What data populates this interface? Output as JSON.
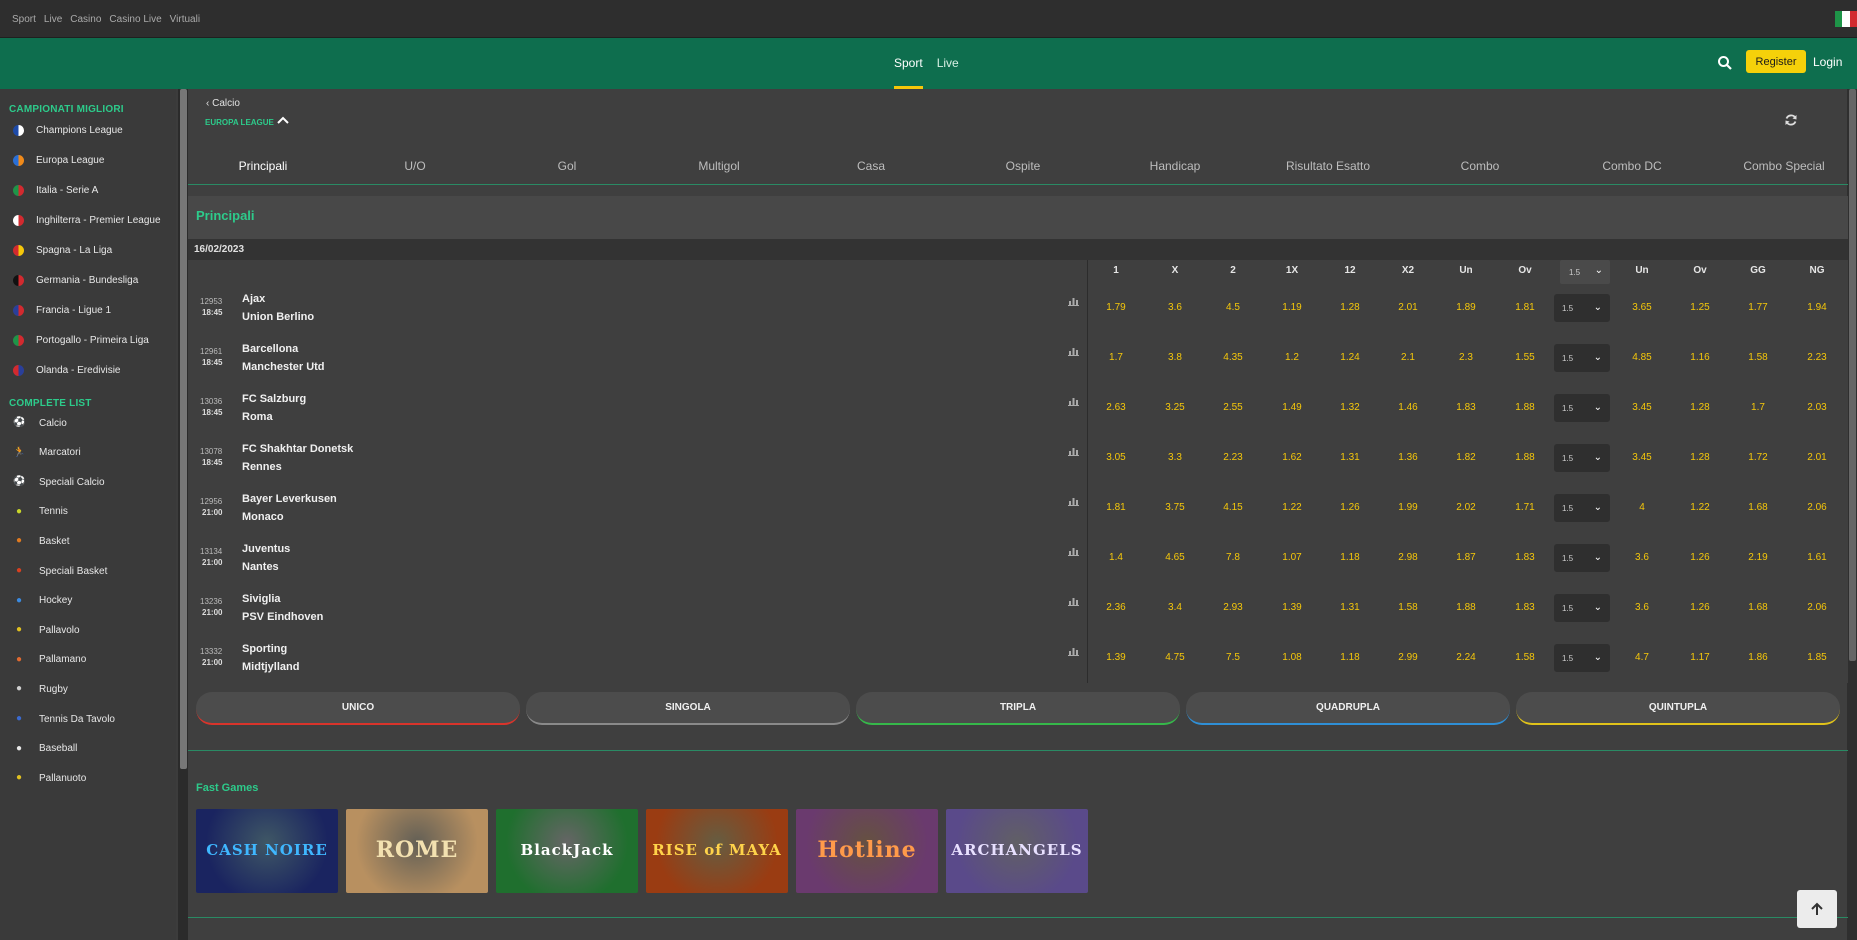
{
  "topbar": {
    "links": [
      "Sport",
      "Live",
      "Casino",
      "Casino Live",
      "Virtuali"
    ]
  },
  "header": {
    "tabs": [
      "Sport",
      "Live"
    ],
    "register": "Register",
    "login": "Login"
  },
  "sidebar": {
    "top_title": "CAMPIONATI MIGLIORI",
    "top": [
      "Champions League",
      "Europa League",
      "Italia - Serie A",
      "Inghilterra - Premier League",
      "Spagna - La Liga",
      "Germania - Bundesliga",
      "Francia - Ligue 1",
      "Portogallo - Primeira Liga",
      "Olanda - Eredivisie"
    ],
    "list_title": "COMPLETE LIST",
    "list": [
      "Calcio",
      "Marcatori",
      "Speciali Calcio",
      "Tennis",
      "Basket",
      "Speciali Basket",
      "Hockey",
      "Pallavolo",
      "Pallamano",
      "Rugby",
      "Tennis Da Tavolo",
      "Baseball",
      "Pallanuoto"
    ]
  },
  "breadcrumb": "Calcio",
  "league": "EUROPA LEAGUE",
  "market_tabs": [
    "Principali",
    "U/O",
    "Gol",
    "Multigol",
    "Casa",
    "Ospite",
    "Handicap",
    "Risultato Esatto",
    "Combo",
    "Combo DC",
    "Combo Special"
  ],
  "section_title": "Principali",
  "date": "16/02/2023",
  "columns": [
    "1",
    "X",
    "2",
    "1X",
    "12",
    "X2",
    "Un",
    "Ov",
    "Un",
    "Ov",
    "GG",
    "NG"
  ],
  "header_select": "1.5",
  "matches": [
    {
      "code": "12953",
      "time": "18:45",
      "home": "Ajax",
      "away": "Union Berlino",
      "sel": "1.5",
      "odds": [
        "1.79",
        "3.6",
        "4.5",
        "1.19",
        "1.28",
        "2.01",
        "1.89",
        "1.81",
        "3.65",
        "1.25",
        "1.77",
        "1.94"
      ]
    },
    {
      "code": "12961",
      "time": "18:45",
      "home": "Barcellona",
      "away": "Manchester Utd",
      "sel": "1.5",
      "odds": [
        "1.7",
        "3.8",
        "4.35",
        "1.2",
        "1.24",
        "2.1",
        "2.3",
        "1.55",
        "4.85",
        "1.16",
        "1.58",
        "2.23"
      ]
    },
    {
      "code": "13036",
      "time": "18:45",
      "home": "FC Salzburg",
      "away": "Roma",
      "sel": "1.5",
      "odds": [
        "2.63",
        "3.25",
        "2.55",
        "1.49",
        "1.32",
        "1.46",
        "1.83",
        "1.88",
        "3.45",
        "1.28",
        "1.7",
        "2.03"
      ]
    },
    {
      "code": "13078",
      "time": "18:45",
      "home": "FC Shakhtar Donetsk",
      "away": "Rennes",
      "sel": "1.5",
      "odds": [
        "3.05",
        "3.3",
        "2.23",
        "1.62",
        "1.31",
        "1.36",
        "1.82",
        "1.88",
        "3.45",
        "1.28",
        "1.72",
        "2.01"
      ]
    },
    {
      "code": "12956",
      "time": "21:00",
      "home": "Bayer Leverkusen",
      "away": "Monaco",
      "sel": "1.5",
      "odds": [
        "1.81",
        "3.75",
        "4.15",
        "1.22",
        "1.26",
        "1.99",
        "2.02",
        "1.71",
        "4",
        "1.22",
        "1.68",
        "2.06"
      ]
    },
    {
      "code": "13134",
      "time": "21:00",
      "home": "Juventus",
      "away": "Nantes",
      "sel": "1.5",
      "odds": [
        "1.4",
        "4.65",
        "7.8",
        "1.07",
        "1.18",
        "2.98",
        "1.87",
        "1.83",
        "3.6",
        "1.26",
        "2.19",
        "1.61"
      ]
    },
    {
      "code": "13236",
      "time": "21:00",
      "home": "Siviglia",
      "away": "PSV Eindhoven",
      "sel": "1.5",
      "odds": [
        "2.36",
        "3.4",
        "2.93",
        "1.39",
        "1.31",
        "1.58",
        "1.88",
        "1.83",
        "3.6",
        "1.26",
        "1.68",
        "2.06"
      ]
    },
    {
      "code": "13332",
      "time": "21:00",
      "home": "Sporting",
      "away": "Midtjylland",
      "sel": "1.5",
      "odds": [
        "1.39",
        "4.75",
        "7.5",
        "1.08",
        "1.18",
        "2.99",
        "2.24",
        "1.58",
        "4.7",
        "1.17",
        "1.86",
        "1.85"
      ]
    }
  ],
  "bet_buttons": [
    {
      "label": "UNICO",
      "color": "#d9342b"
    },
    {
      "label": "SINGOLA",
      "color": "#8a8a8a"
    },
    {
      "label": "TRIPLA",
      "color": "#36b84a"
    },
    {
      "label": "QUADRUPLA",
      "color": "#2f8fd6"
    },
    {
      "label": "QUINTUPLA",
      "color": "#e0c21a"
    }
  ],
  "fast_games_title": "Fast Games",
  "games": [
    {
      "name": "CASH NOIRE",
      "bg": "#1a2460",
      "fg": "#3fb7ff"
    },
    {
      "name": "ROME",
      "bg": "#b89060",
      "fg": "#f3e1b0"
    },
    {
      "name": "BlackJack",
      "bg": "#1f6f2e",
      "fg": "#ffffff"
    },
    {
      "name": "RISE of MAYA",
      "bg": "#9a3c12",
      "fg": "#ffd34a"
    },
    {
      "name": "Hotline",
      "bg": "#6a3a6e",
      "fg": "#ff9a4a"
    },
    {
      "name": "ARCHANGELS",
      "bg": "#5a4a8a",
      "fg": "#e8e0ff"
    }
  ]
}
